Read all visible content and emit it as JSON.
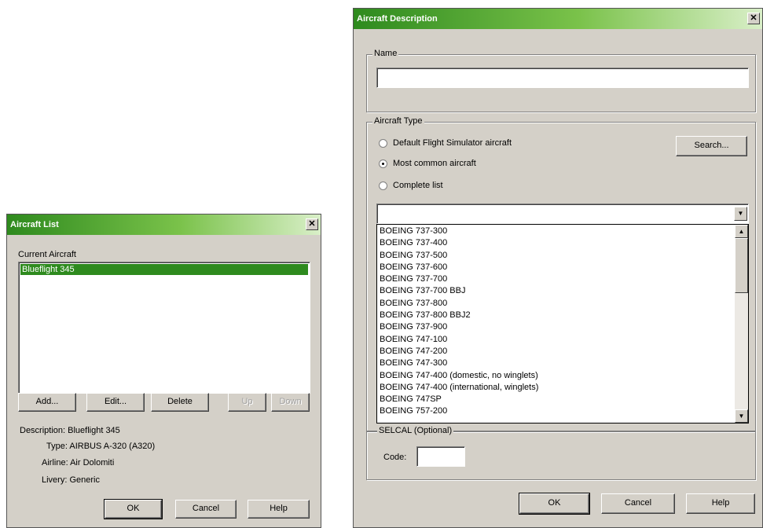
{
  "aircraft_list": {
    "title": "Aircraft List",
    "current_label": "Current Aircraft",
    "items": [
      "Blueflight 345"
    ],
    "buttons": {
      "add": "Add...",
      "edit": "Edit...",
      "delete": "Delete",
      "up": "Up",
      "down": "Down"
    },
    "details": {
      "description": "Description: Blueflight 345",
      "type": "Type: AIRBUS A-320 (A320)",
      "airline": "Airline: Air Dolomiti",
      "livery": "Livery: Generic"
    },
    "footer": {
      "ok": "OK",
      "cancel": "Cancel",
      "help": "Help"
    }
  },
  "aircraft_description": {
    "title": "Aircraft Description",
    "name_group": "Name",
    "name_value": "",
    "type_group": "Aircraft Type",
    "radios": [
      {
        "label": "Default Flight Simulator aircraft",
        "selected": false
      },
      {
        "label": "Most common aircraft",
        "selected": true
      },
      {
        "label": "Complete list",
        "selected": false
      }
    ],
    "search_button": "Search...",
    "combo_value": "",
    "dropdown_items": [
      "BOEING 737-300",
      "BOEING 737-400",
      "BOEING 737-500",
      "BOEING 737-600",
      "BOEING 737-700",
      "BOEING 737-700 BBJ",
      "BOEING 737-800",
      "BOEING 737-800 BBJ2",
      "BOEING 737-900",
      "BOEING 747-100",
      "BOEING 747-200",
      "BOEING 747-300",
      "BOEING 747-400 (domestic, no winglets)",
      "BOEING 747-400 (international, winglets)",
      "BOEING 747SP",
      "BOEING 757-200"
    ],
    "selcal_group": "SELCAL (Optional)",
    "code_label": "Code:",
    "code_value": "",
    "footer": {
      "ok": "OK",
      "cancel": "Cancel",
      "help": "Help"
    }
  },
  "icons": {
    "close": "close-icon",
    "arrow_down": "arrow-down-icon",
    "arrow_up": "arrow-up-icon"
  },
  "colors": {
    "title_gradient_start": "#2e8a1e",
    "selection": "#2e8a1e",
    "dialog_face": "#d4d0c8"
  }
}
